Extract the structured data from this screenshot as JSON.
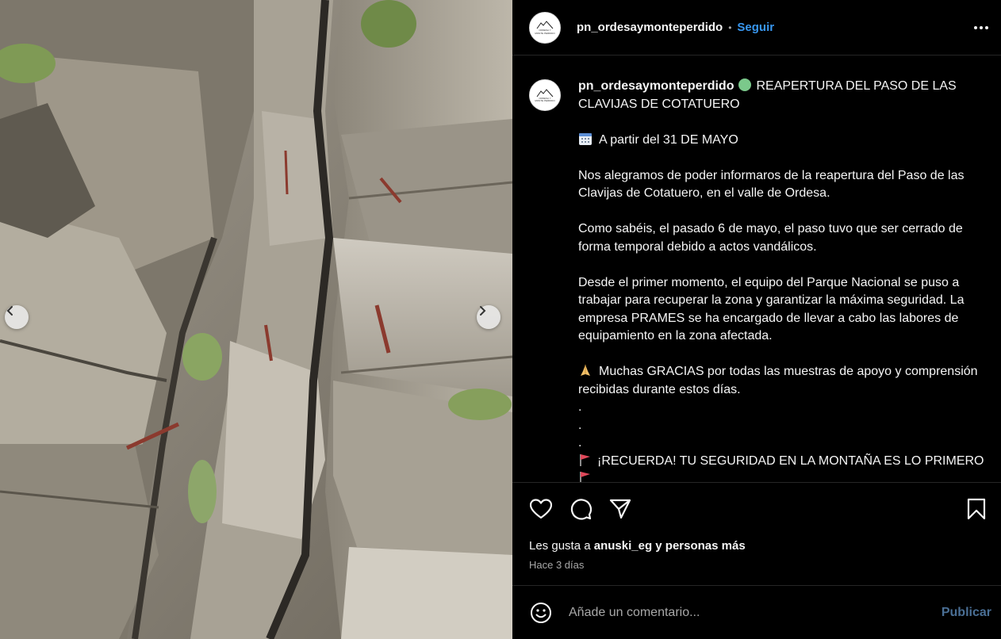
{
  "photo": {
    "alt_colors": {
      "rock_light": "#b9b3a6",
      "rock_mid": "#8a8478",
      "rock_dark": "#3c3832",
      "grass": "#7f9a55",
      "clamp": "#8b3a2e"
    }
  },
  "header": {
    "username": "pn_ordesaymonteperdido",
    "separator": "•",
    "follow_label": "Seguir"
  },
  "avatar": {
    "line1": "ORDESA Y",
    "line2": "MONTE PERDIDO"
  },
  "caption": {
    "username": "pn_ordesaymonteperdido",
    "title": "REAPERTURA DEL PASO DE LAS CLAVIJAS DE COTATUERO",
    "date_line": "A partir del 31 DE MAYO",
    "paragraph1": "Nos alegramos de poder informaros de la reapertura del Paso de las Clavijas de Cotatuero, en el valle de Ordesa.",
    "paragraph2": "Como sabéis, el pasado 6 de mayo, el paso tuvo que ser cerrado de forma temporal debido a actos vandálicos.",
    "paragraph3": "Desde el primer momento, el equipo del Parque Nacional se puso a trabajar para recuperar la zona y garantizar la máxima seguridad. La empresa PRAMES se ha encargado de llevar a cabo las labores de equipamiento en la zona afectada.",
    "paragraph4": "Muchas GRACIAS por todas las muestras de apoyo y comprensión recibidas durante estos días.",
    "dots": [
      ".",
      ".",
      "."
    ],
    "reminder": "¡RECUERDA! TU SEGURIDAD EN LA MONTAÑA ES LO PRIMERO"
  },
  "actions": {
    "likes_prefix": "Les gusta a ",
    "likes_user": "anuski_eg",
    "likes_suffix": " y personas más",
    "time_ago": "Hace 3 días"
  },
  "comment": {
    "placeholder": "Añade un comentario...",
    "publish_label": "Publicar"
  },
  "colors": {
    "accent_follow": "#3897f0",
    "publish_disabled": "#4a6f95",
    "divider": "#262626"
  }
}
